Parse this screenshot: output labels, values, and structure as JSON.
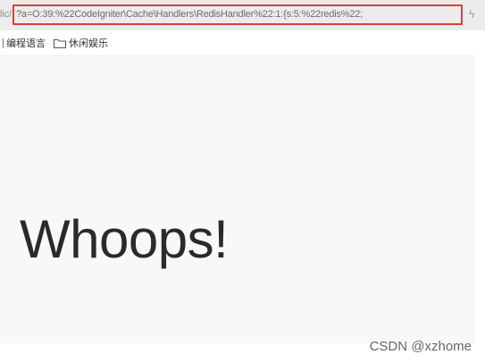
{
  "address_bar": {
    "url_prefix": "lic/",
    "url": "?a=O:39:%22CodeIgniter\\Cache\\Handlers\\RedisHandler%22:1:{s:5:%22redis%22;",
    "highlight_color": "#d9403a"
  },
  "bookmarks": [
    {
      "label": "编程语言",
      "icon": "folder-icon"
    },
    {
      "label": "休闲娱乐",
      "icon": "folder-icon"
    }
  ],
  "page": {
    "heading": "Whoops!"
  },
  "watermark": "CSDN @xzhome"
}
